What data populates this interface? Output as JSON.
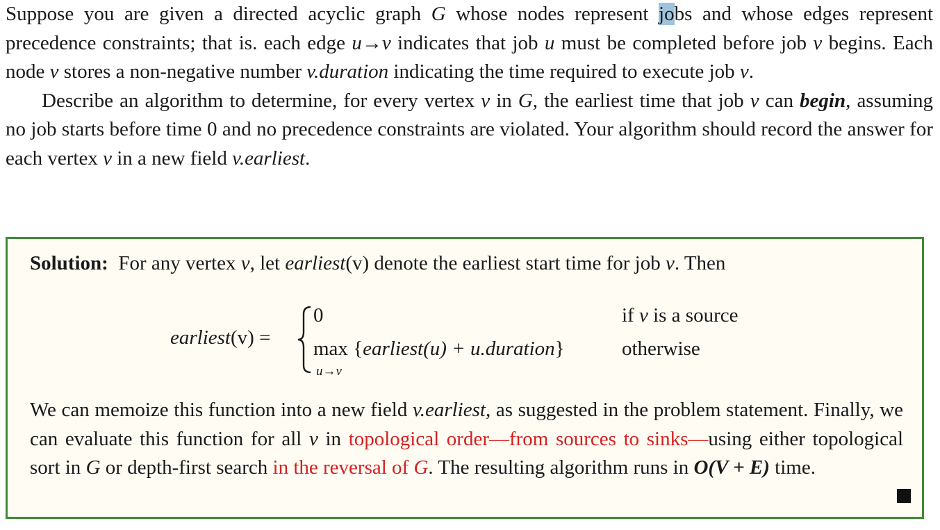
{
  "problem": {
    "p1_a": "Suppose you are given a directed acyclic graph ",
    "p1_G": "G",
    "p1_b": " whose nodes represent ",
    "p1_jo": "jo",
    "p1_bs": "b",
    "p1_c": "s and whose edges represent precedence constraints; that is. each edge ",
    "p1_edge": "u→v",
    "p1_d": " indicates that job ",
    "p1_u": "u",
    "p1_e": " must be completed before job ",
    "p1_v1": "v",
    "p1_f": " begins. Each node ",
    "p1_v2": "v",
    "p1_g": " stores a non-negative number ",
    "p1_vdur": "v.duration",
    "p1_h": " indicating the time required to execute job ",
    "p1_v3": "v",
    "p1_i": ".",
    "p2_a": "Describe an algorithm to determine, for every vertex ",
    "p2_v1": "v",
    "p2_b": " in ",
    "p2_G": "G",
    "p2_c": ", the earliest time that job ",
    "p2_v2": "v",
    "p2_d": " can ",
    "p2_begin": "begin",
    "p2_e": ", assuming no job starts before time 0 and no precedence constraints are violated. Your algorithm should record the answer for each vertex ",
    "p2_v3": "v",
    "p2_f": " in a new field ",
    "p2_vearl": "v.earliest",
    "p2_g": "."
  },
  "solution": {
    "label": "Solution:",
    "intro_a": "For any vertex ",
    "intro_v": "v",
    "intro_b": ", let ",
    "intro_fn": "earliest",
    "intro_arg": "(v)",
    "intro_c": " denote the earliest start time for job ",
    "intro_v2": "v",
    "intro_d": ". Then",
    "eq_lhs_fn": "earliest",
    "eq_lhs_arg": "(v) =",
    "case1_value": "0",
    "case1_cond_a": "if ",
    "case1_cond_v": "v",
    "case1_cond_b": " is a source",
    "case2_max": "max",
    "case2_expr_a": " {",
    "case2_expr_fn": "earliest",
    "case2_expr_b": "(u) + u.duration",
    "case2_expr_c": "}",
    "case2_sub": "u→v",
    "case2_cond": "otherwise",
    "body_a": "We can memoize this function into a new field ",
    "body_vearl": "v.earliest",
    "body_b": ", as suggested in the problem statement. Finally, we can evaluate this function for all ",
    "body_v": "v",
    "body_c": " in ",
    "body_red1": "topological order—from sources to sinks—",
    "body_d": "using either topological sort in ",
    "body_G1": "G",
    "body_e": " or depth-first search ",
    "body_red2a": "in the reversal of ",
    "body_red2G": "G",
    "body_f": ". The resulting algorithm runs in ",
    "body_O": "O(V + E)",
    "body_g": " time."
  },
  "colors": {
    "box_border": "#3e8b37",
    "box_bg": "#fffcf4",
    "highlight": "#9fc3dc",
    "red_text": "#d42020"
  }
}
